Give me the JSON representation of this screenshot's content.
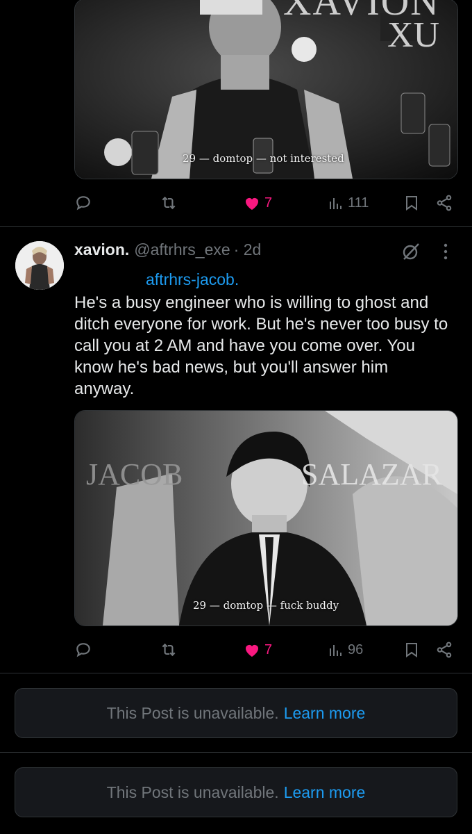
{
  "post1": {
    "image": {
      "alt_subject": "concert photo",
      "title_line1": "XAVION",
      "title_line2": "XU",
      "caption": "29 — domtop — not interested"
    },
    "actions": {
      "likes": "7",
      "views": "111"
    }
  },
  "post2": {
    "author_name": "xavion.",
    "handle": "@aftrhrs_exe",
    "time": "· 2d",
    "mention": "aftrhrs-jacob.",
    "text": "He's a busy engineer who is willing to ghost and ditch everyone for work. But he's never too busy to call you at 2 AM and have you come over. You know he's bad news, but you'll answer him anyway.",
    "image": {
      "title_left": "JACOB",
      "title_right": "SALAZAR",
      "caption": "29 — domtop — fuck buddy"
    },
    "actions": {
      "likes": "7",
      "views": "96"
    }
  },
  "unavailable": [
    {
      "text": "This Post is unavailable.",
      "link": "Learn more"
    },
    {
      "text": "This Post is unavailable.",
      "link": "Learn more"
    }
  ],
  "colors": {
    "like": "#f91880",
    "link": "#1d9bf0",
    "muted": "#71767b"
  }
}
